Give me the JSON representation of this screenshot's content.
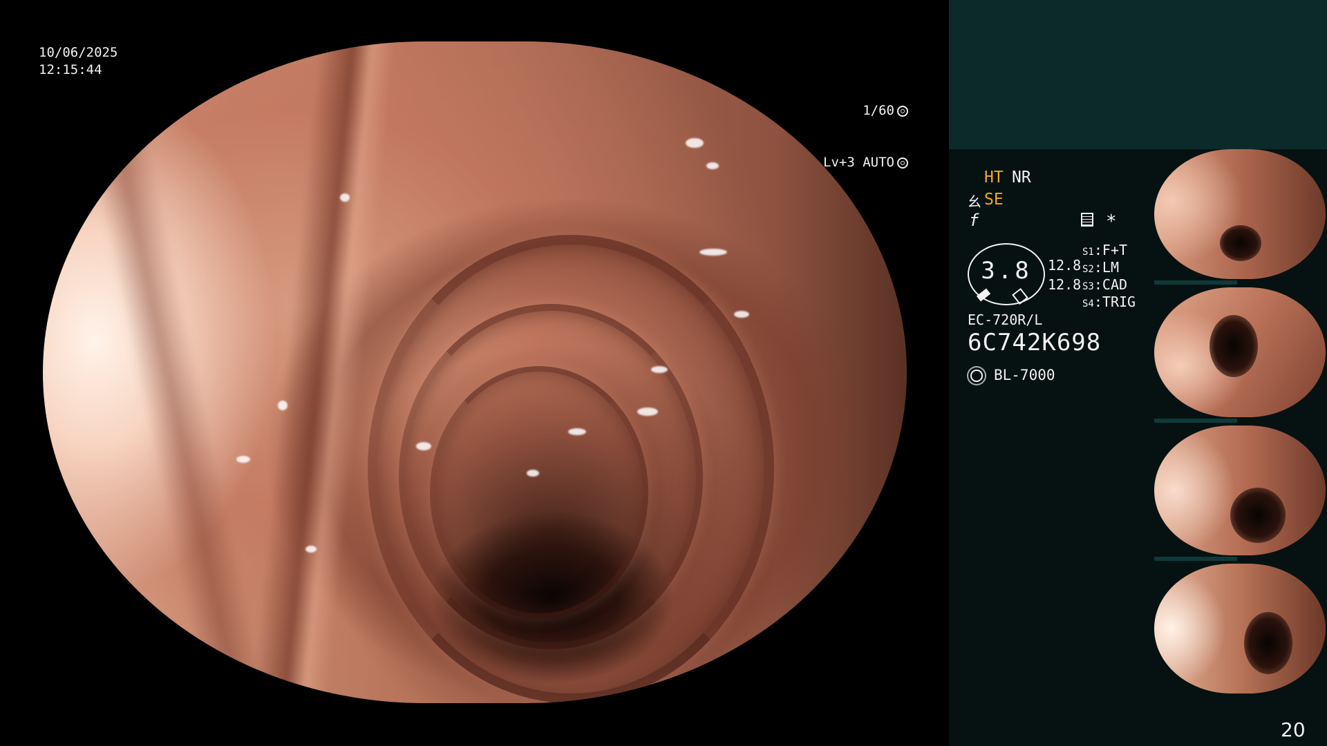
{
  "overlay": {
    "date": "10/06/2025",
    "time": "12:15:44",
    "shutter": "1/60",
    "level": "Lv+3 AUTO"
  },
  "modes": {
    "ht": "HT",
    "nr": "NR",
    "se": "SE",
    "se_icon": "⺓",
    "f_icon": "f"
  },
  "icons": {
    "document": "document-icon",
    "star": "*",
    "light": "sun-icon",
    "shutter": "aperture-icon",
    "auto": "auto-iris-icon"
  },
  "gauge": {
    "value": "3.8",
    "num1": "12.8",
    "num2": "12.8"
  },
  "switches": [
    {
      "key": "S1",
      "value": "F+T"
    },
    {
      "key": "S2",
      "value": "LM"
    },
    {
      "key": "S3",
      "value": "CAD"
    },
    {
      "key": "S4",
      "value": "TRIG"
    }
  ],
  "scope": {
    "model": "EC-720R/L",
    "serial": "6C742K698",
    "light_source": "BL-7000"
  },
  "page_number": "20",
  "colors": {
    "accent": "#f5a623",
    "panel_top": "#0c2a2a",
    "panel": "#061211"
  }
}
